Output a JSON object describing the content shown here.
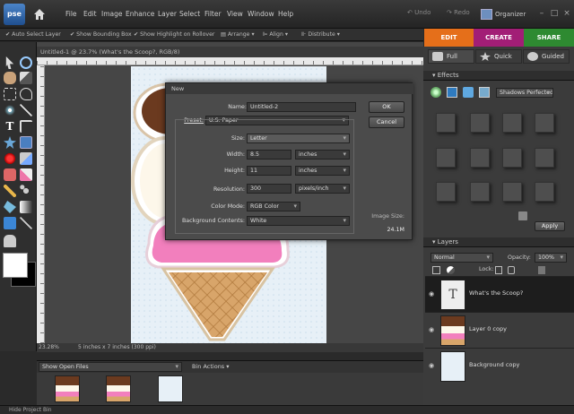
{
  "app": {
    "logo": "pse"
  },
  "menu": [
    "File",
    "Edit",
    "Image",
    "Enhance",
    "Layer",
    "Select",
    "Filter",
    "View",
    "Window",
    "Help"
  ],
  "header": {
    "undo": "Undo",
    "redo": "Redo",
    "organizer": "Organizer"
  },
  "mode_tabs": {
    "edit": "EDIT",
    "create": "CREATE",
    "share": "SHARE"
  },
  "options": {
    "auto_select": "Auto Select Layer",
    "bounding_box": "Show Bounding Box",
    "highlight": "Show Highlight on Rollover",
    "arrange": "Arrange",
    "align": "Align",
    "distribute": "Distribute"
  },
  "document": {
    "tab_title": "Untitled-1 @ 23.7% (What's the Scoop?, RGB/8)",
    "zoom": "23.28%",
    "size_info": "5 inches x 7 inches (300 ppi)"
  },
  "dialog": {
    "title": "New",
    "name_label": "Name:",
    "name_value": "Untitled-2",
    "ok": "OK",
    "cancel": "Cancel",
    "preset_label": "Preset:",
    "preset_value": "U.S. Paper",
    "size_label": "Size:",
    "size_value": "Letter",
    "width_label": "Width:",
    "width_value": "8.5",
    "width_unit": "inches",
    "height_label": "Height:",
    "height_value": "11",
    "height_unit": "inches",
    "resolution_label": "Resolution:",
    "resolution_value": "300",
    "resolution_unit": "pixels/inch",
    "color_mode_label": "Color Mode:",
    "color_mode_value": "RGB Color",
    "background_label": "Background Contents:",
    "background_value": "White",
    "image_size_label": "Image Size:",
    "image_size_value": "24.1M"
  },
  "panel": {
    "subtabs": [
      "Full",
      "Quick",
      "Guided"
    ],
    "effects_title": "Effects",
    "effects_filter": "Shadows Perfected",
    "apply": "Apply",
    "layers_title": "Layers",
    "blend_mode": "Normal",
    "opacity_label": "Opacity:",
    "opacity_value": "100%",
    "lock_label": "Lock:"
  },
  "layers": [
    {
      "name": "What's the Scoop?",
      "type": "text",
      "selected": true
    },
    {
      "name": "Layer 0 copy",
      "type": "image",
      "selected": false
    },
    {
      "name": "Background copy",
      "type": "image",
      "selected": false
    }
  ],
  "bin": {
    "show": "Show Open Files",
    "actions": "Bin Actions",
    "hide": "Hide Project Bin"
  },
  "colors": {
    "edit": "#e56f1a",
    "create": "#a21e76",
    "share": "#2e8a31",
    "accent": "#4b84c8"
  }
}
